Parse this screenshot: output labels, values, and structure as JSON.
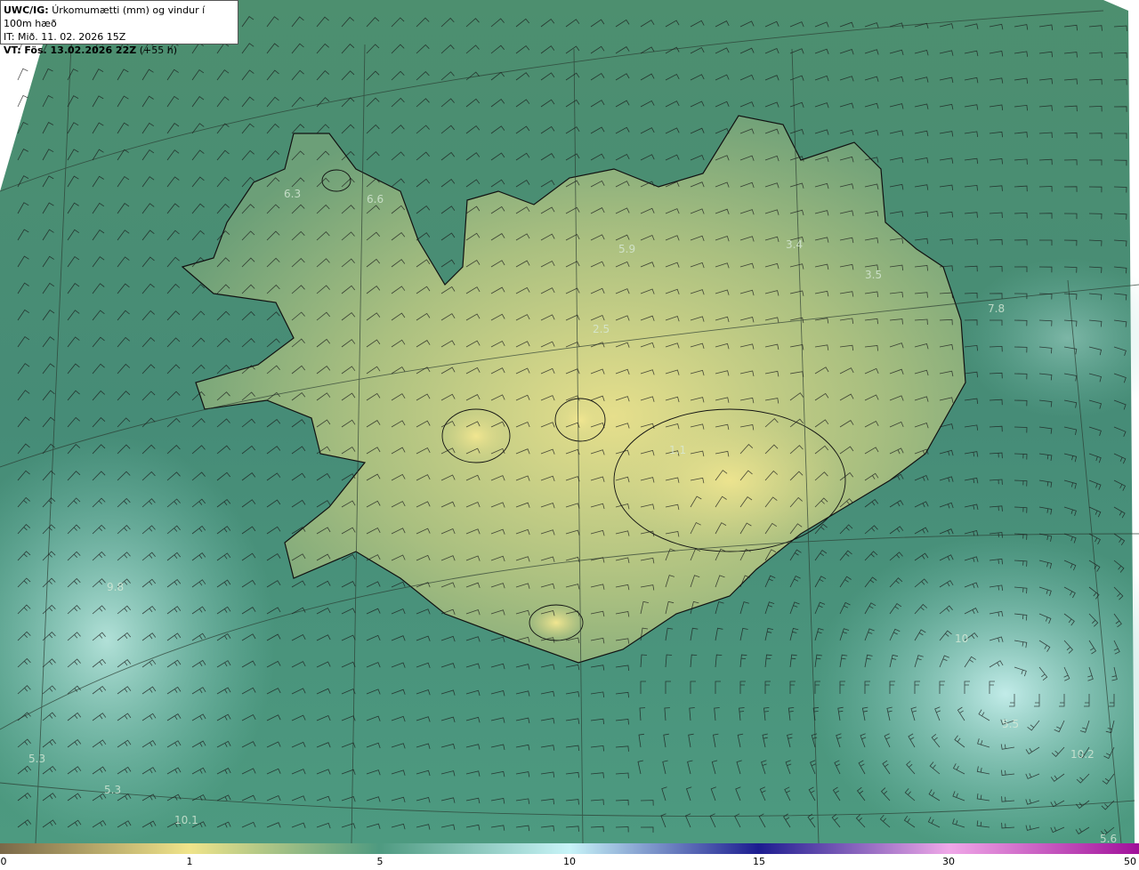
{
  "header": {
    "model": "UWC/IG:",
    "title": "Úrkomumætti (mm) og vindur í 100m hæð",
    "init_time": "IT: Mið. 11. 02. 2026 15Z",
    "valid_prefix": "VT:",
    "valid_time": "Fös. 13.02.2026 22Z",
    "lead": "(+55 h)"
  },
  "map_labels": [
    "6.3",
    "6.6",
    "5.9",
    "3.4",
    "3.5",
    "7.8",
    "2.5",
    "1.1",
    "9.8",
    "10",
    "5.5",
    "5.3",
    "5.3",
    "10.1",
    "10.2",
    "5.6"
  ],
  "colorbar": {
    "ticks": [
      "0",
      "1",
      "5",
      "10",
      "15",
      "30",
      "50"
    ],
    "colors": {
      "c0": "#7a6848",
      "c1": "#f0e48a",
      "c5": "#4e9a80",
      "c10": "#c8f4f8",
      "c15": "#1c1c90",
      "c30": "#f0a8e8",
      "c50": "#a0109a"
    }
  },
  "colors": {
    "ocean": "#4a8f77",
    "land_dry": "#cfd38a",
    "land_wet": "#6aa07a",
    "ocean_wet": "#8fd2c8",
    "coast": "#111111",
    "grid": "#2a3a30",
    "barb": "#1a1a1a"
  }
}
